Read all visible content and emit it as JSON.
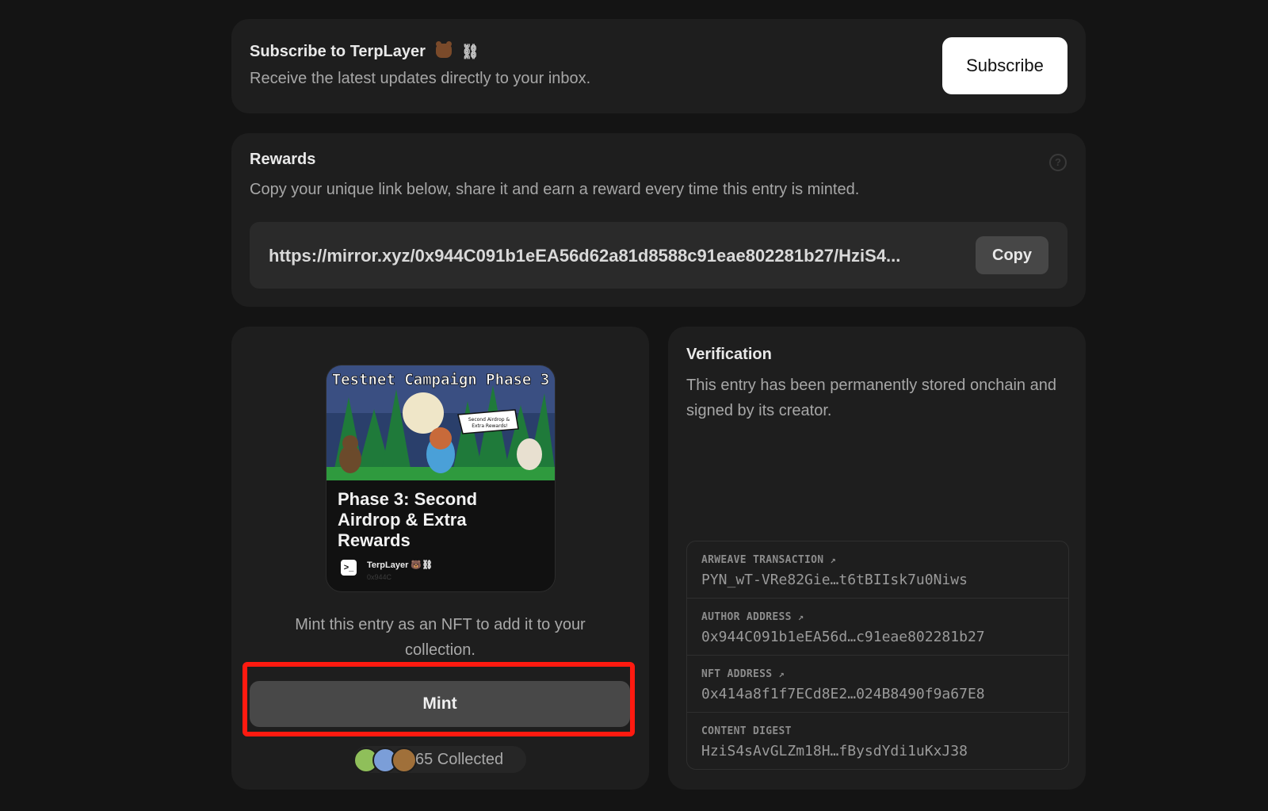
{
  "subscribe": {
    "title": "Subscribe to TerpLayer",
    "chain_emoji": "⛓",
    "description": "Receive the latest updates directly to your inbox.",
    "button_label": "Subscribe"
  },
  "rewards": {
    "title": "Rewards",
    "description": "Copy your unique link below, share it and earn a reward every time this entry is minted.",
    "help_glyph": "?",
    "link": "https://mirror.xyz/0x944C091b1eEA56d62a81d8588c91eae802281b27/HziS4...",
    "copy_label": "Copy"
  },
  "mint": {
    "nft": {
      "banner": "Testnet Campaign Phase 3",
      "bubble_line1": "Second Airdrop &",
      "bubble_line2": "Extra Rewards!",
      "title": "Phase 3: Second Airdrop & Extra Rewards",
      "author": "TerpLayer 🐻⛓",
      "author_address": "0x944C",
      "avatar_glyph": ">_"
    },
    "description": "Mint this entry as an NFT to add it to your collection.",
    "button_label": "Mint",
    "collected_text": "65 Collected"
  },
  "verification": {
    "title": "Verification",
    "description": "This entry has been permanently stored onchain and signed by its creator.",
    "external_link_glyph": "↗",
    "rows": [
      {
        "label": "ARWEAVE TRANSACTION",
        "value": "PYN_wT-VRe82Gie…t6tBIIsk7u0Niws",
        "has_link": true
      },
      {
        "label": "AUTHOR ADDRESS",
        "value": "0x944C091b1eEA56d…c91eae802281b27",
        "has_link": true
      },
      {
        "label": "NFT ADDRESS",
        "value": "0x414a8f1f7ECd8E2…024B8490f9a67E8",
        "has_link": true
      },
      {
        "label": "CONTENT DIGEST",
        "value": "HziS4sAvGLZm18H…fBysdYdi1uKxJ38",
        "has_link": false
      }
    ]
  },
  "colors": {
    "background": "#141414",
    "card": "#1e1e1e",
    "highlight": "#ff1a10",
    "mint_button": "#484848"
  }
}
